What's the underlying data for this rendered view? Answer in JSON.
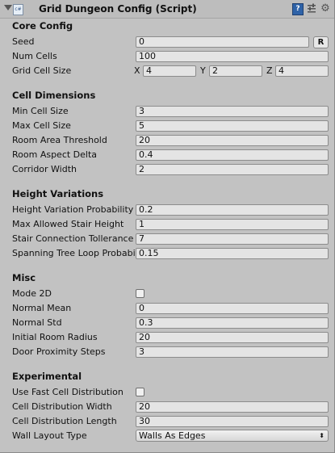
{
  "header": {
    "title": "Grid Dungeon Config (Script)",
    "script_icon_text": "c#",
    "icons": {
      "foldout": "foldout-arrow-icon",
      "script": "script-icon",
      "help": "help-icon",
      "preset": "preset-icon",
      "gear": "gear-icon"
    },
    "help_glyph": "?",
    "gear_glyph": "⚙"
  },
  "core": {
    "heading": "Core Config",
    "seed_label": "Seed",
    "seed_value": "0",
    "reseed_button": "R",
    "num_cells_label": "Num Cells",
    "num_cells_value": "100",
    "grid_cell_size_label": "Grid Cell Size",
    "x_label": "X",
    "x_value": "4",
    "y_label": "Y",
    "y_value": "2",
    "z_label": "Z",
    "z_value": "4"
  },
  "cell_dimensions": {
    "heading": "Cell Dimensions",
    "rows": [
      {
        "label": "Min Cell Size",
        "value": "3"
      },
      {
        "label": "Max Cell Size",
        "value": "5"
      },
      {
        "label": "Room Area Threshold",
        "value": "20"
      },
      {
        "label": "Room Aspect Delta",
        "value": "0.4"
      },
      {
        "label": "Corridor Width",
        "value": "2"
      }
    ]
  },
  "height_variations": {
    "heading": "Height Variations",
    "rows": [
      {
        "label": "Height Variation Probability",
        "value": "0.2"
      },
      {
        "label": "Max Allowed Stair Height",
        "value": "1"
      },
      {
        "label": "Stair Connection Tollerance",
        "value": "7"
      },
      {
        "label": "Spanning Tree Loop Probability",
        "value": "0.15"
      }
    ]
  },
  "misc": {
    "heading": "Misc",
    "mode2d_label": "Mode 2D",
    "mode2d_checked": false,
    "rows": [
      {
        "label": "Normal Mean",
        "value": "0"
      },
      {
        "label": "Normal Std",
        "value": "0.3"
      },
      {
        "label": "Initial Room Radius",
        "value": "20"
      },
      {
        "label": "Door Proximity Steps",
        "value": "3"
      }
    ]
  },
  "experimental": {
    "heading": "Experimental",
    "fast_dist_label": "Use Fast Cell Distribution",
    "fast_dist_checked": false,
    "rows": [
      {
        "label": "Cell Distribution Width",
        "value": "20"
      },
      {
        "label": "Cell Distribution Length",
        "value": "30"
      }
    ],
    "wall_layout_label": "Wall Layout Type",
    "wall_layout_value": "Walls As Edges",
    "dropdown_arrow": "⬍"
  }
}
